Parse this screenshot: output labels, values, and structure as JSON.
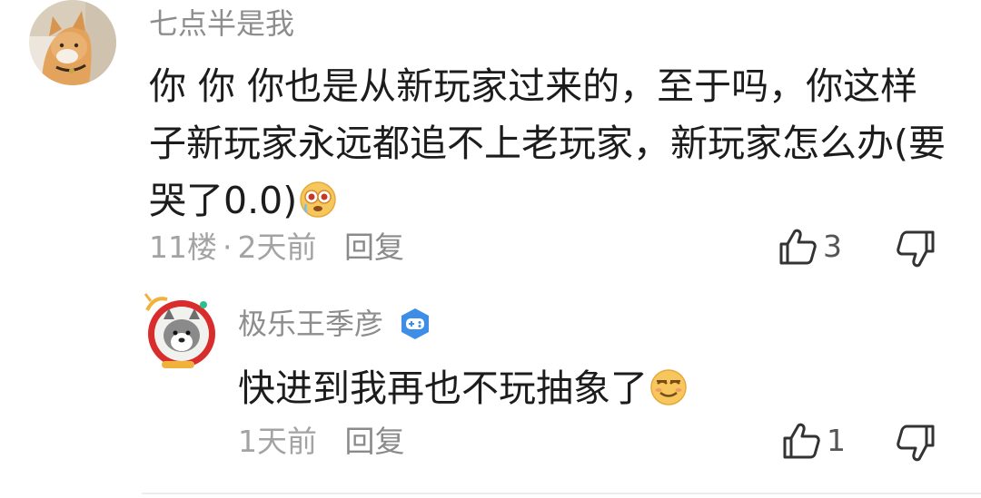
{
  "comment": {
    "author": "七点半是我",
    "content": "你 你 你也是从新玩家过来的，至于吗，你这样子新玩家永远都追不上老玩家，新玩家怎么办(要哭了0.0)",
    "content_emoji": "crying-face-emoji",
    "floor": "11楼",
    "separator": "·",
    "time": "2天前",
    "reply_label": "回复",
    "like_count": "3"
  },
  "reply": {
    "author": "极乐王季彦",
    "badge_icon": "game-controller-badge-icon",
    "badge_color": "#3e8ee8",
    "content": "快进到我再也不玩抽象了",
    "content_emoji": "smug-face-emoji",
    "time": "1天前",
    "reply_label": "回复",
    "like_count": "1"
  },
  "colors": {
    "author": "#8d8d8d",
    "text": "#1c1c1c",
    "meta": "#a3a3a3"
  }
}
